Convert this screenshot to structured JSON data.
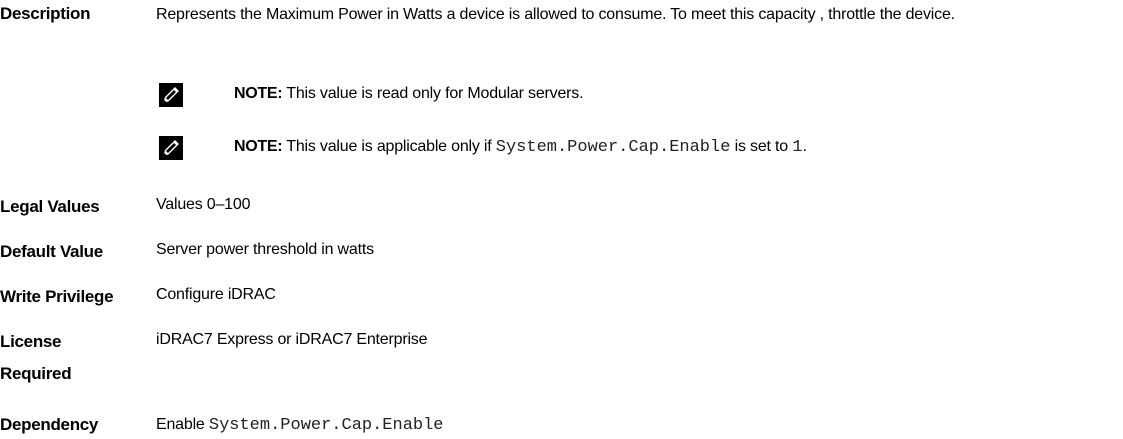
{
  "description": {
    "label": "Description",
    "text": "Represents the Maximum Power in Watts a device is allowed to consume. To meet this capacity , throttle the device."
  },
  "notes": [
    {
      "icon": "note-pencil-icon",
      "label": "NOTE:",
      "text": "This value is read only for Modular servers."
    },
    {
      "icon": "note-pencil-icon",
      "label": "NOTE:",
      "text_before": "This value is applicable only if",
      "code": "System.Power.Cap.Enable",
      "text_middle": "is set to",
      "code_value": "1",
      "text_after": "."
    }
  ],
  "legal_values": {
    "label": "Legal Values",
    "value": "Values 0–100"
  },
  "default_value": {
    "label": "Default Value",
    "value": "Server power threshold in watts"
  },
  "write_privilege": {
    "label": "Write Privilege",
    "value": "Configure iDRAC"
  },
  "license_required": {
    "label_line1": "License",
    "label_line2": "Required",
    "value": "iDRAC7 Express or iDRAC7 Enterprise"
  },
  "dependency": {
    "label": "Dependency",
    "value_prefix": "Enable",
    "code": "System.Power.Cap.Enable"
  }
}
